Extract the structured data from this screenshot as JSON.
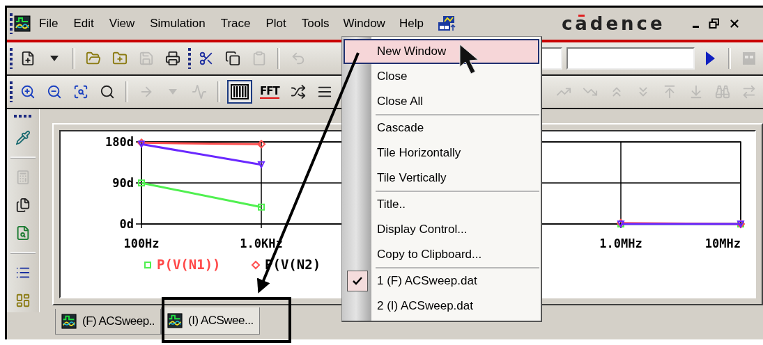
{
  "menu_bar": {
    "items": [
      {
        "label": "File",
        "selected": false
      },
      {
        "label": "Edit",
        "selected": false
      },
      {
        "label": "View",
        "selected": false
      },
      {
        "label": "Simulation",
        "selected": false
      },
      {
        "label": "Trace",
        "selected": false
      },
      {
        "label": "Plot",
        "selected": false
      },
      {
        "label": "Tools",
        "selected": false
      },
      {
        "label": "Window",
        "selected": true
      },
      {
        "label": "Help",
        "selected": false
      }
    ]
  },
  "logo": {
    "text": "cadence"
  },
  "toolbar_1": [
    {
      "kind": "grip"
    },
    {
      "kind": "new",
      "disabled": false
    },
    {
      "kind": "caret",
      "disabled": false
    },
    {
      "kind": "separator"
    },
    {
      "kind": "open",
      "disabled": false
    },
    {
      "kind": "open-add",
      "disabled": false
    },
    {
      "kind": "save",
      "disabled": true
    },
    {
      "kind": "print",
      "disabled": false
    },
    {
      "kind": "grip"
    },
    {
      "kind": "cut",
      "disabled": false
    },
    {
      "kind": "copy",
      "disabled": false
    },
    {
      "kind": "paste",
      "disabled": true
    },
    {
      "kind": "separator"
    },
    {
      "kind": "undo",
      "disabled": true
    },
    {
      "kind": "spacer"
    },
    {
      "kind": "field"
    },
    {
      "kind": "field"
    },
    {
      "kind": "play",
      "disabled": false
    },
    {
      "kind": "separator"
    },
    {
      "kind": "panel",
      "disabled": true
    }
  ],
  "toolbar_2": [
    {
      "kind": "grip"
    },
    {
      "kind": "zoom-in",
      "disabled": false,
      "pressed": false
    },
    {
      "kind": "zoom-out",
      "disabled": false,
      "pressed": false
    },
    {
      "kind": "zoom-area",
      "disabled": false,
      "pressed": false
    },
    {
      "kind": "zoom-fit",
      "disabled": false,
      "pressed": false
    },
    {
      "kind": "separator"
    },
    {
      "kind": "arrow",
      "disabled": true,
      "pressed": false
    },
    {
      "kind": "caret",
      "disabled": true,
      "pressed": false
    },
    {
      "kind": "chart",
      "disabled": true,
      "pressed": false
    },
    {
      "kind": "separator"
    },
    {
      "kind": "bars",
      "disabled": false,
      "pressed": true
    },
    {
      "kind": "fft",
      "label": "FFT",
      "disabled": false,
      "pressed": false
    },
    {
      "kind": "cross",
      "disabled": false,
      "pressed": false
    },
    {
      "kind": "lines",
      "disabled": false,
      "pressed": false
    },
    {
      "kind": "spacer"
    },
    {
      "kind": "peak",
      "disabled": true,
      "pressed": false
    },
    {
      "kind": "trough",
      "disabled": true,
      "pressed": false
    },
    {
      "kind": "rise",
      "disabled": true,
      "pressed": false
    },
    {
      "kind": "fall",
      "disabled": true,
      "pressed": false
    },
    {
      "kind": "max",
      "disabled": true,
      "pressed": false
    },
    {
      "kind": "min",
      "disabled": true,
      "pressed": false
    },
    {
      "kind": "find",
      "disabled": true,
      "pressed": false
    },
    {
      "kind": "swap",
      "disabled": true,
      "pressed": false
    }
  ],
  "side_toolbar": [
    {
      "kind": "grip"
    },
    {
      "kind": "probe",
      "disabled": false
    },
    {
      "kind": "separator"
    },
    {
      "kind": "calc",
      "disabled": true
    },
    {
      "kind": "files",
      "disabled": false
    },
    {
      "kind": "file-search",
      "disabled": false
    },
    {
      "kind": "separator"
    },
    {
      "kind": "list",
      "disabled": false
    },
    {
      "kind": "dashboard",
      "disabled": false
    }
  ],
  "plot": {
    "legend_labels": [
      {
        "color": "#ff4848"
      },
      {
        "color": "#000000"
      }
    ],
    "chart_data": {
      "type": "line",
      "grid": true,
      "legend": "bottom",
      "categories": [
        "100Hz",
        "1.0KHz",
        null,
        null,
        "1.0MHz",
        "10MHz"
      ],
      "ylim": [
        0,
        180
      ],
      "yticks": [
        {
          "value": 0,
          "label": "0d"
        },
        {
          "value": 90,
          "label": "90d"
        },
        {
          "value": 180,
          "label": "180d"
        }
      ],
      "series": [
        {
          "name": "P(V(N1))",
          "color": "#50f050",
          "marker": "square",
          "values": [
            90,
            37,
            null,
            null,
            0,
            0
          ]
        },
        {
          "name": "P(V(N2)",
          "color": "#ff5050",
          "marker": "diamond",
          "values": [
            178,
            175,
            null,
            null,
            2,
            0
          ]
        },
        {
          "color": "#6a28ff",
          "marker": "triangle",
          "values": [
            175,
            130,
            null,
            null,
            0,
            0
          ]
        }
      ]
    }
  },
  "tabs": [
    {
      "label": "(F) ACSweep..",
      "selected": false
    },
    {
      "label": "(I) ACSwee...",
      "selected": true
    }
  ],
  "window_menu": [
    {
      "kind": "item",
      "label": "New Window",
      "selected": true,
      "checked": false
    },
    {
      "kind": "item",
      "label": "Close",
      "selected": false,
      "checked": false
    },
    {
      "kind": "item",
      "label": "Close All",
      "selected": false,
      "checked": false
    },
    {
      "kind": "separator"
    },
    {
      "kind": "item",
      "label": "Cascade",
      "selected": false,
      "checked": false
    },
    {
      "kind": "item",
      "label": "Tile Horizontally",
      "selected": false,
      "checked": false
    },
    {
      "kind": "item",
      "label": "Tile Vertically",
      "selected": false,
      "checked": false
    },
    {
      "kind": "separator"
    },
    {
      "kind": "item",
      "label": "Title..",
      "selected": false,
      "checked": false
    },
    {
      "kind": "item",
      "label": "Display Control...",
      "selected": false,
      "checked": false
    },
    {
      "kind": "item",
      "label": "Copy to Clipboard...",
      "selected": false,
      "checked": false
    },
    {
      "kind": "separator"
    },
    {
      "kind": "item",
      "label": "1 (F) ACSweep.dat",
      "selected": false,
      "checked": true
    },
    {
      "kind": "item",
      "label": "2 (I) ACSweep.dat",
      "selected": false,
      "checked": false
    }
  ]
}
